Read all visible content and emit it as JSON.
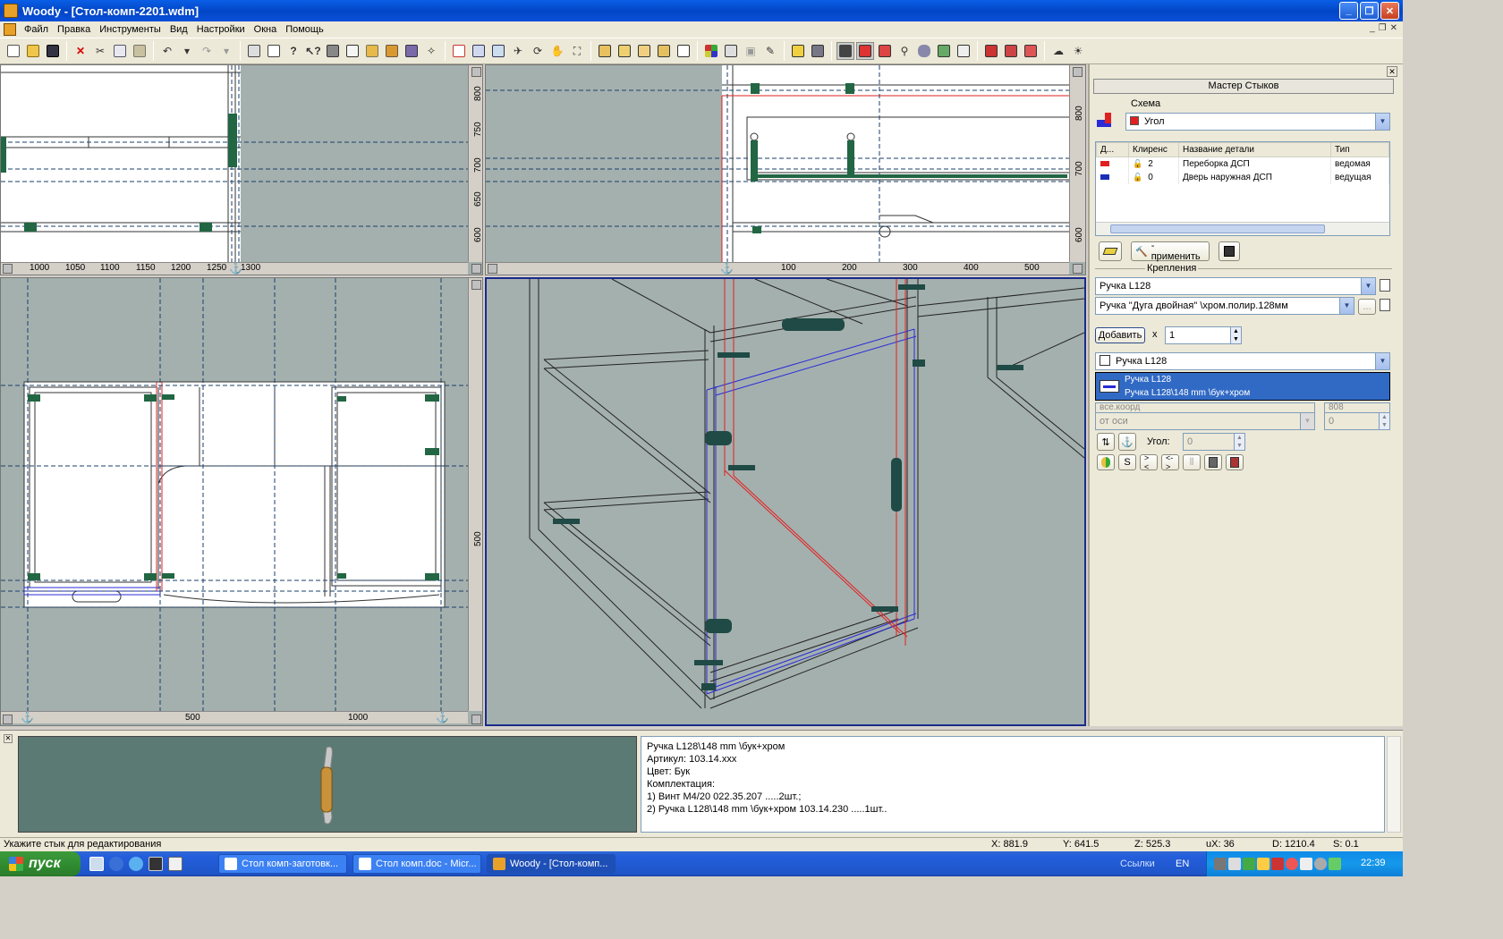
{
  "window": {
    "title": "Woody - [Стол-комп-2201.wdm]",
    "buttons": {
      "minimize": "_",
      "maximize": "❐",
      "close": "✕"
    }
  },
  "menu": {
    "items": [
      "Файл",
      "Правка",
      "Инструменты",
      "Вид",
      "Настройки",
      "Окна",
      "Помощь"
    ],
    "mdi": {
      "minimize": "_",
      "restore": "❐",
      "close": "✕"
    }
  },
  "viewports": {
    "top_left": {
      "ruler_x": [
        "1000",
        "1050",
        "1100",
        "1150",
        "1200",
        "1250",
        "1300"
      ],
      "ruler_y": [
        "800",
        "750",
        "700",
        "650",
        "600"
      ]
    },
    "top_right": {
      "ruler_x": [
        "100",
        "200",
        "300",
        "400",
        "500"
      ],
      "ruler_y": [
        "800",
        "700",
        "600"
      ]
    },
    "bottom_left": {
      "ruler_x": [
        "500",
        "1000"
      ],
      "ruler_y": [
        "500"
      ]
    }
  },
  "panel": {
    "title": "Мастер Стыков",
    "schema_label": "Схема",
    "schema_value": "Угол",
    "table": {
      "headers": [
        "Д...",
        "Клиренс",
        "Название детали",
        "Тип"
      ],
      "rows": [
        {
          "color": "#e02020",
          "clearance": "2",
          "name": "Переборка ДСП",
          "type": "ведомая"
        },
        {
          "color": "#1a2fb8",
          "clearance": "0",
          "name": "Дверь наружная ДСП",
          "type": "ведущая"
        }
      ]
    },
    "apply_label": "- применить",
    "fastenings_label": "Крепления",
    "fastening_type": "Ручка  L128",
    "fastening_model": "Ручка \"Дуга двойная\" \\хром.полир.128мм",
    "more_label": "...",
    "add_label": "Добавить",
    "times_label": "x",
    "count_value": "1",
    "selected_combo": "Ручка  L128",
    "list_items": [
      "Ручка  L128",
      "Ручка L128\\148 mm \\бук+хром"
    ],
    "hidden_combo1": "все.коорд",
    "hidden_value1": "808",
    "axis_combo": "от оси",
    "axis_value": "0",
    "angle_label": "Угол:",
    "angle_value": "0",
    "small_btns": [
      "S",
      "><",
      "<->"
    ]
  },
  "info": {
    "lines": [
      "Ручка L128\\148 mm \\бук+хром",
      "Артикул: 103.14.xxx",
      "Цвет: Бук",
      "Комплектация:",
      "1) Винт М4/20 022.35.207 .....2шт.;",
      "2) Ручка L128\\148 mm \\бук+хром 103.14.230 .....1шт.."
    ]
  },
  "status": {
    "hint": "Укажите стык для редактирования",
    "x": "X: 881.9",
    "y": "Y: 641.5",
    "z": "Z: 525.3",
    "ux": "uX: 36",
    "d": "D: 1210.4",
    "s": "S: 0.1"
  },
  "taskbar": {
    "start": "пуск",
    "tasks": [
      "Стол комп-заготовк...",
      "Стол комп.doc - Micr...",
      "Woody - [Стол-комп..."
    ],
    "links": "Ссылки",
    "lang": "EN",
    "clock": "22:39"
  },
  "colors": {
    "viewport": "#a4b0ae",
    "accent": "#316ac5",
    "red_edge": "#e02020",
    "blue_edge": "#2a2ad8"
  }
}
